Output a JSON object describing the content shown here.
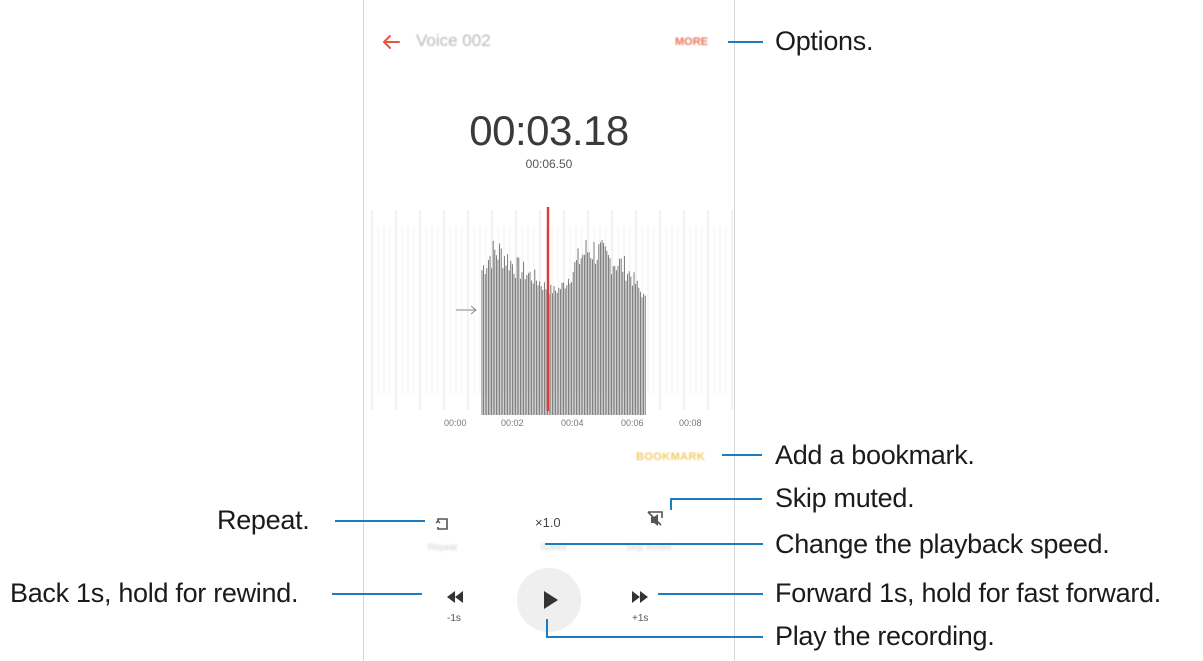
{
  "recording": {
    "title": "Voice 002",
    "more_label": "MORE",
    "elapsed": "00:03.18",
    "total": "00:06.50",
    "bookmark_label": "BOOKMARK"
  },
  "timeline": {
    "ticks": [
      "00:00",
      "00:02",
      "00:04",
      "00:06",
      "00:08"
    ],
    "playhead_seconds": 3.18,
    "playhead_color": "#e53935"
  },
  "controls": {
    "repeat_label": "Repeat",
    "speed_value": "×1.0",
    "speed_label": "Speed",
    "skip_muted_label": "Skip muted",
    "rewind_label": "-1s",
    "forward_label": "+1s"
  },
  "callouts": {
    "options": "Options.",
    "bookmark": "Add a bookmark.",
    "skip_muted": "Skip muted.",
    "speed": "Change the playback speed.",
    "forward": "Forward 1s, hold for fast forward.",
    "play": "Play the recording.",
    "repeat": "Repeat.",
    "back": "Back 1s, hold for rewind."
  },
  "colors": {
    "accent": "#e8755c",
    "bookmark": "#f3cb6b",
    "callout_line": "#1f7bbf"
  }
}
